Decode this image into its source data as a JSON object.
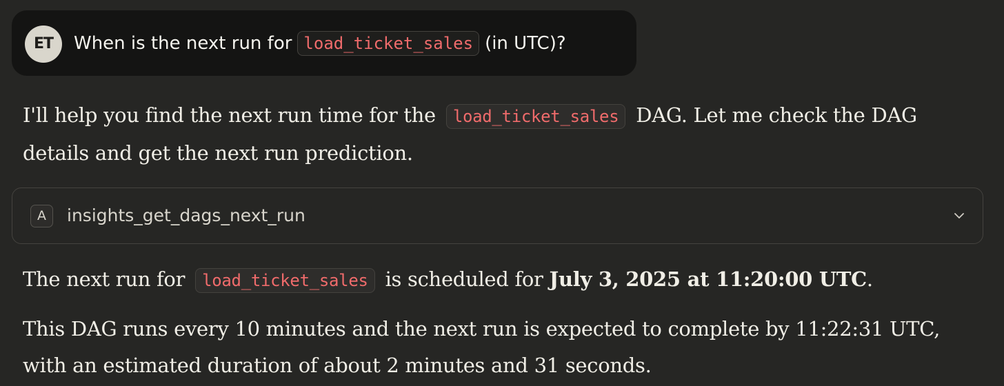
{
  "user_message": {
    "avatar_initials": "ET",
    "text_before": "When is the next run for",
    "code": "load_ticket_sales",
    "text_after": "(in UTC)?"
  },
  "assistant": {
    "intro": {
      "before": "I'll help you find the next run time for the",
      "code": "load_ticket_sales",
      "after": "DAG. Let me check the DAG details and get the next run prediction."
    },
    "tool_call": {
      "badge": "A",
      "name": "insights_get_dags_next_run",
      "icon": "chevron-down-icon"
    },
    "answer": {
      "before": "The next run for",
      "code": "load_ticket_sales",
      "middle": "is scheduled for",
      "bold": "July 3, 2025 at 11:20:00 UTC",
      "after": "."
    },
    "details": "This DAG runs every 10 minutes and the next run is expected to complete by 11:22:31 UTC, with an estimated duration of about 2 minutes and 31 seconds."
  },
  "colors": {
    "background": "#262624",
    "user_bubble": "#141413",
    "code_text": "#ef6b6b",
    "text": "#f0eee6"
  }
}
